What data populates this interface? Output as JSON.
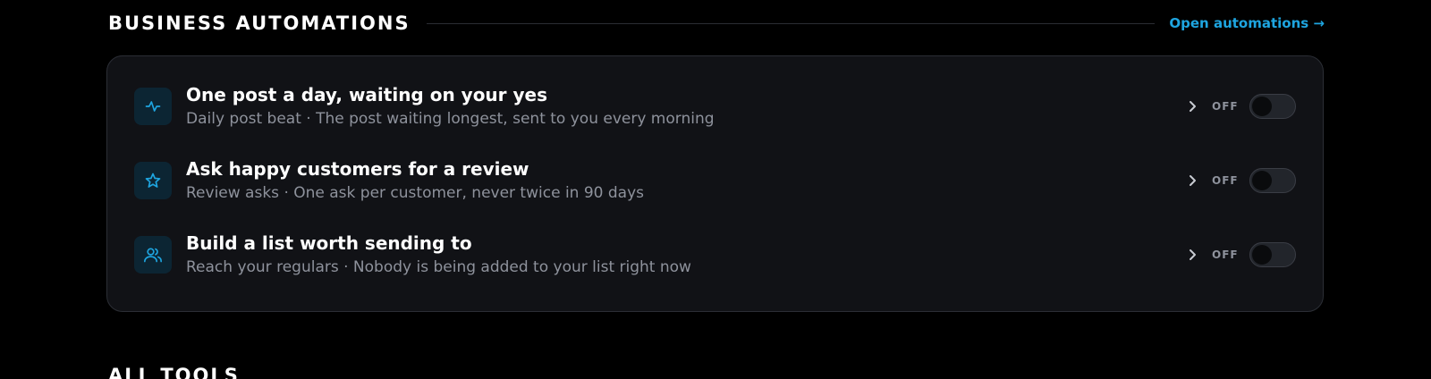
{
  "section": {
    "title": "BUSINESS AUTOMATIONS",
    "link_label": "Open automations →"
  },
  "automations": [
    {
      "icon": "activity-pulse-icon",
      "title": "One post a day, waiting on your yes",
      "subtitle": "Daily post beat · The post waiting longest, sent to you every morning",
      "state_label": "OFF",
      "enabled": false
    },
    {
      "icon": "star-icon",
      "title": "Ask happy customers for a review",
      "subtitle": "Review asks · One ask per customer, never twice in 90 days",
      "state_label": "OFF",
      "enabled": false
    },
    {
      "icon": "users-icon",
      "title": "Build a list worth sending to",
      "subtitle": "Reach your regulars · Nobody is being added to your list right now",
      "state_label": "OFF",
      "enabled": false
    }
  ],
  "next_section": {
    "title": "ALL TOOLS"
  },
  "colors": {
    "accent": "#1ea5e0",
    "panel_bg": "#111216",
    "icon_bg": "#0c2533",
    "muted_text": "#8e929c"
  }
}
